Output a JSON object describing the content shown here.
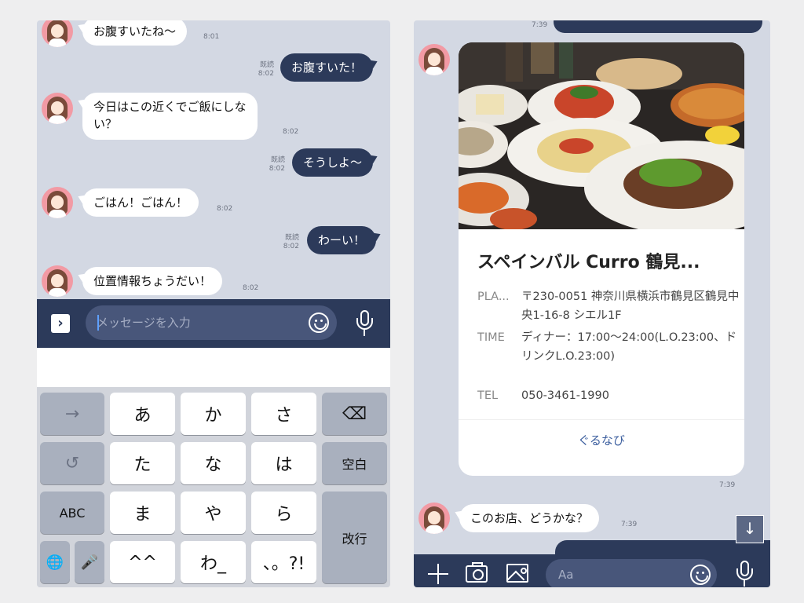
{
  "left": {
    "messages": [
      {
        "dir": "in",
        "text": "お腹すいたね〜",
        "time": "8:01"
      },
      {
        "dir": "out",
        "text": "お腹すいた！",
        "read": "既読",
        "time": "8:02"
      },
      {
        "dir": "in",
        "text": "今日はこの近くでご飯にしな",
        "text2": "い？",
        "time": "8:02"
      },
      {
        "dir": "out",
        "text": "そうしよ〜",
        "read": "既読",
        "time": "8:02"
      },
      {
        "dir": "in",
        "text": "ごはん！ごはん！",
        "time": "8:02"
      },
      {
        "dir": "out",
        "text": "わーい！",
        "read": "既読",
        "time": "8:02"
      },
      {
        "dir": "in",
        "text": "位置情報ちょうだい！",
        "time": "8:02"
      }
    ],
    "input_placeholder": "メッセージを入力",
    "keyboard": {
      "row1": [
        "→",
        "あ",
        "か",
        "さ",
        "⌫"
      ],
      "row2": [
        "↺",
        "た",
        "な",
        "は",
        "空白"
      ],
      "row3": [
        "ABC",
        "ま",
        "や",
        "ら",
        "改行"
      ],
      "row4": [
        "🌐",
        "🎤",
        "^^",
        "わ_",
        "、。?!"
      ]
    }
  },
  "right": {
    "top_time": "7:39",
    "card": {
      "title": "スペインバル Curro 鶴見...",
      "place_label": "PLA...",
      "place_value": "〒230-0051 神奈川県横浜市鶴見区鶴見中央1-16-8 シエル1F",
      "time_label": "TIME",
      "time_value": "ディナー：17:00〜24:00(L.O.23:00、ドリンクL.O.23:00)",
      "tel_label": "TEL",
      "tel_value": "050-3461-1990",
      "link": "ぐるなび"
    },
    "card_time": "7:39",
    "message": {
      "text": "このお店、どうかな？",
      "time": "7:39"
    },
    "input_placeholder": "Aa",
    "down_arrow": "↓"
  }
}
